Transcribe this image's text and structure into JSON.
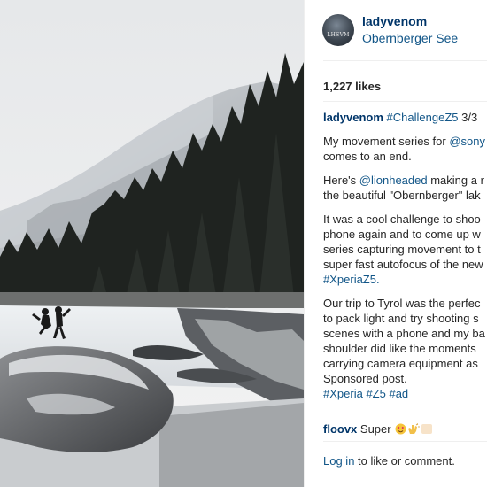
{
  "post": {
    "username": "ladyvenom",
    "location": "Obernberger See",
    "avatar_text": "LHSVM",
    "likes": "1,227 likes"
  },
  "caption": {
    "author": "ladyvenom",
    "p1_tag": "#ChallengeZ5",
    "p1_suffix": " 3/3",
    "p2_l1_text": "My movement series for ",
    "p2_l1_tag": "@sony",
    "p2_l2": "comes to an end.",
    "p3_l1_text": "Here's ",
    "p3_l1_tag": "@lionheaded",
    "p3_l1_suffix": " making a r",
    "p3_l2": "the beautiful \"Obernberger\" lak",
    "p4_l1": "It was a cool challenge to shoo",
    "p4_l2": "phone again and to come up w",
    "p4_l3": "series capturing movement to t",
    "p4_l4": "super fast autofocus of the new",
    "p4_tag": "#XperiaZ5.",
    "p5_l1": "Our trip to Tyrol was the perfec",
    "p5_l2": "to pack light and try shooting s",
    "p5_l3": "scenes with a phone and my ba",
    "p5_l4": "shoulder did like the moments",
    "p5_l5": "carrying camera equipment as",
    "p5_l6": "Sponsored post.",
    "p5_tags": [
      "#Xperia",
      "#Z5",
      "#ad"
    ]
  },
  "comment": {
    "user": "floovx",
    "text": " Super"
  },
  "footer": {
    "login_link": "Log in",
    "login_suffix": " to like or comment."
  },
  "colors": {
    "username": "#003569",
    "link": "#125688",
    "text": "#262626",
    "divider": "#efefef"
  }
}
